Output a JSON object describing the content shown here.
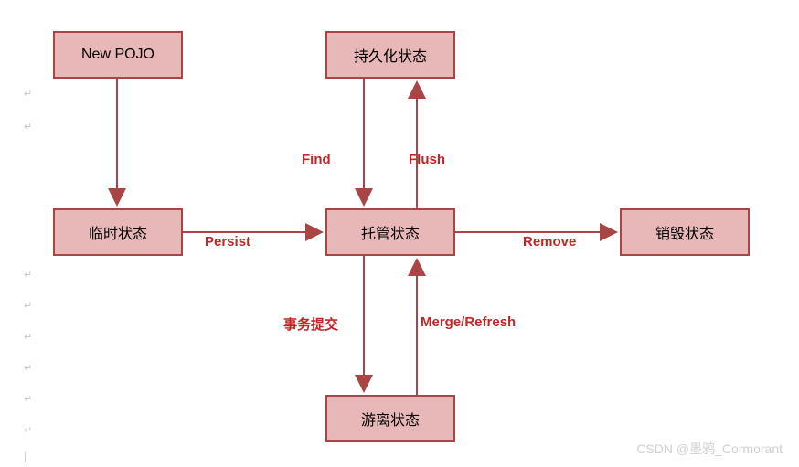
{
  "boxes": {
    "new_pojo": "New POJO",
    "persistent": "持久化状态",
    "transient": "临时状态",
    "managed": "托管状态",
    "removed": "销毁状态",
    "detached": "游离状态"
  },
  "edges": {
    "persist": "Persist",
    "find": "Find",
    "flush": "Flush",
    "commit": "事务提交",
    "merge": "Merge/Refresh",
    "remove": "Remove"
  },
  "colors": {
    "box_fill": "#e8b7b7",
    "box_border": "#a94545",
    "arrow": "#a94545",
    "label": "#c02626"
  },
  "watermark": "CSDN @墨鸦_Cormorant"
}
